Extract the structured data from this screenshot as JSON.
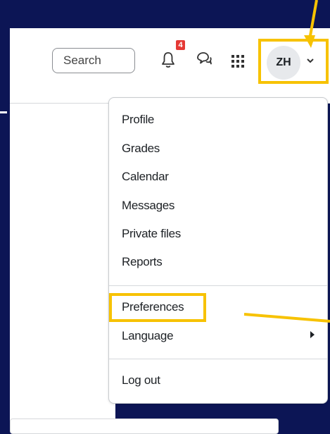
{
  "header": {
    "search_label": "Search",
    "notification_count": "4",
    "avatar_initials": "ZH"
  },
  "icons": {
    "bell": "bell-icon",
    "chat": "chat-bubbles-icon",
    "grid": "app-grid-icon",
    "chevron": "chevron-down-icon",
    "submenu": "caret-right-icon"
  },
  "user_menu": {
    "items": [
      {
        "label": "Profile"
      },
      {
        "label": "Grades"
      },
      {
        "label": "Calendar"
      },
      {
        "label": "Messages"
      },
      {
        "label": "Private files"
      },
      {
        "label": "Reports"
      },
      {
        "label": "Preferences"
      },
      {
        "label": "Language"
      },
      {
        "label": "Log out"
      }
    ]
  },
  "colors": {
    "background": "#0c1555",
    "highlight": "#f7c200",
    "badge": "#e53935"
  }
}
